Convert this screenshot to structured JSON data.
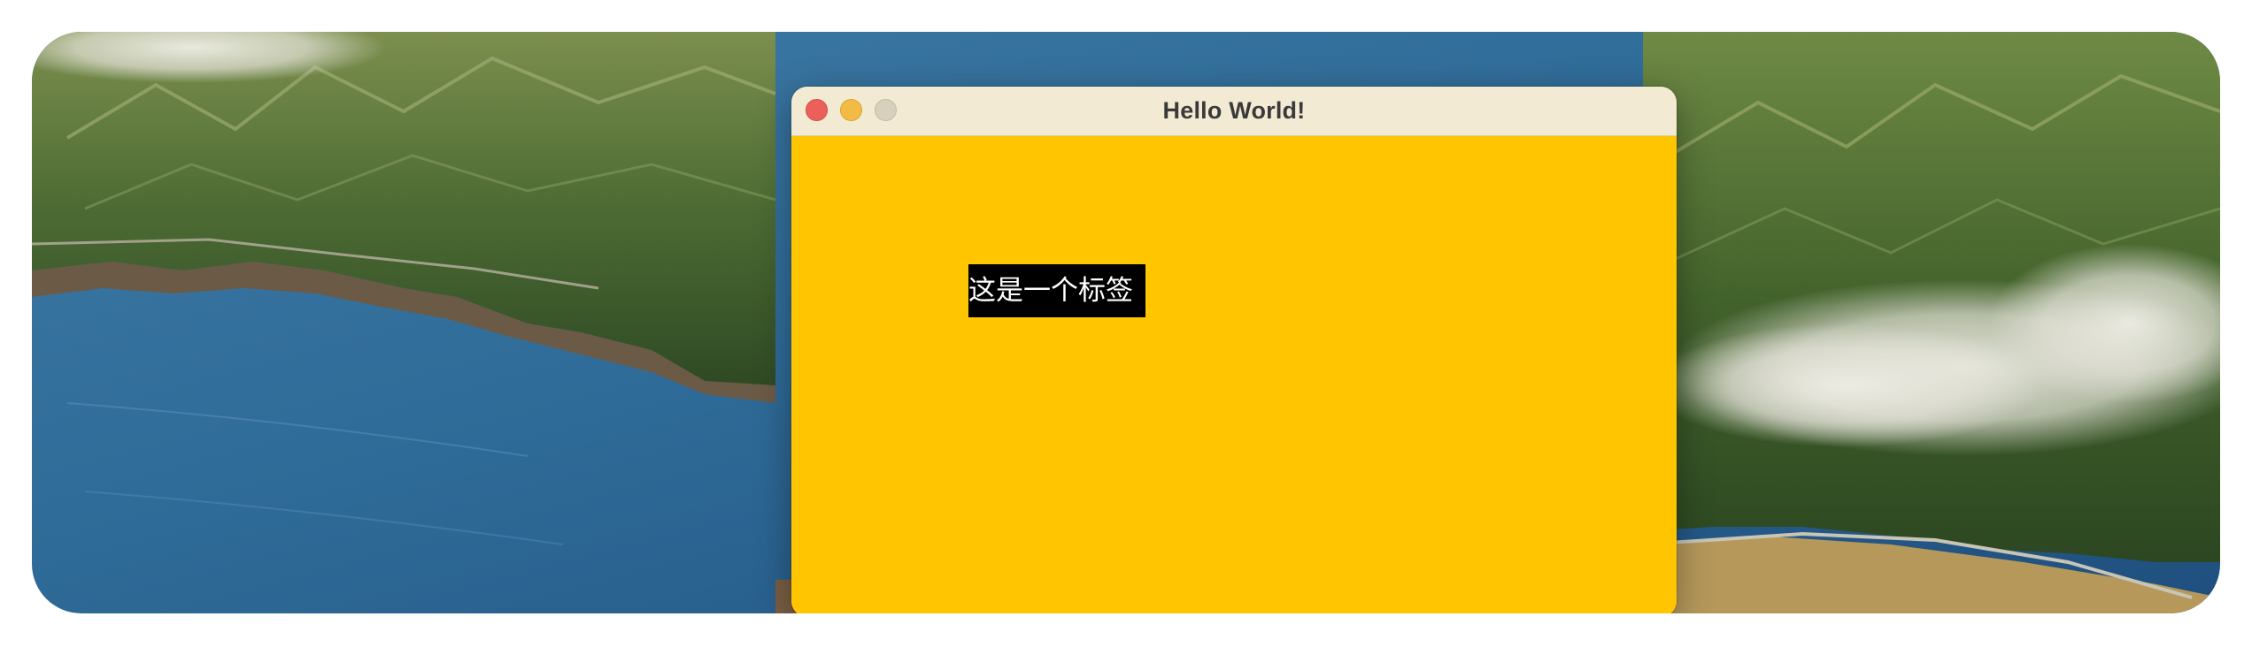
{
  "window": {
    "title": "Hello World!",
    "background_color": "#FFC600",
    "titlebar_color": "#F3EAD3",
    "controls": {
      "close_color": "#EC5F5A",
      "minimize_color": "#F1BB45",
      "maximize_color": "#D6D0BC"
    }
  },
  "label": {
    "text": "这是一个标签",
    "background_color": "#000000",
    "text_color": "#FFFFFF"
  },
  "desktop": {
    "wallpaper": "coastal-mountains-landscape"
  }
}
